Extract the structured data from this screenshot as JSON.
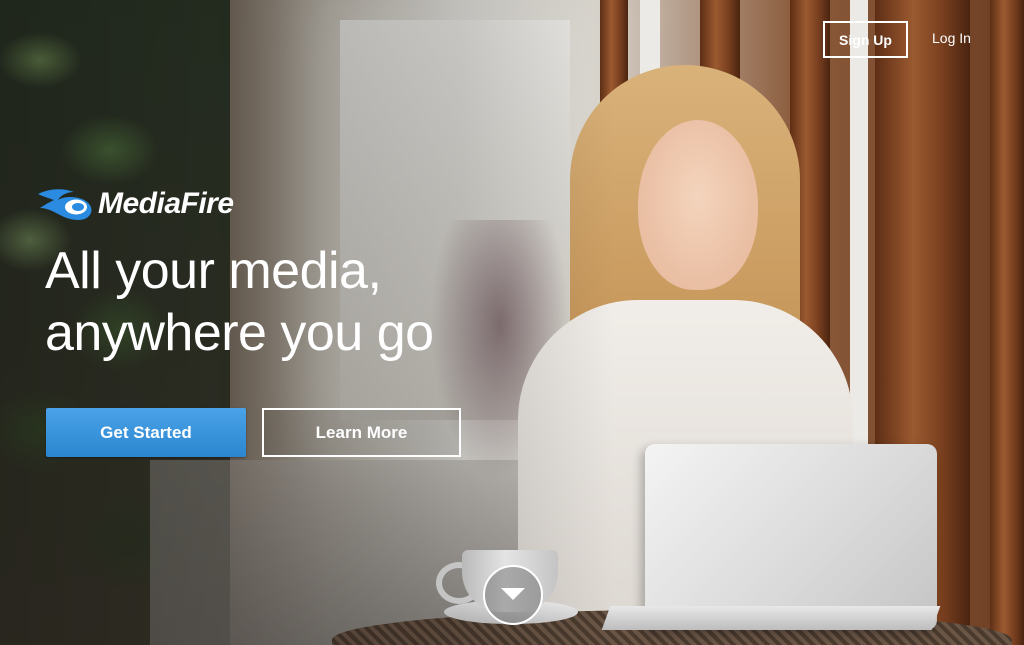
{
  "nav": {
    "signup_label": "Sign Up",
    "login_label": "Log In"
  },
  "logo": {
    "text": "MediaFire",
    "icon": "mediafire-flame-icon"
  },
  "hero": {
    "headline_line1": "All your media,",
    "headline_line2": "anywhere you go",
    "primary_cta": "Get Started",
    "secondary_cta": "Learn More",
    "scroll_icon": "chevron-down-icon"
  },
  "colors": {
    "primary_button": "#2c86cf",
    "logo_blue": "#2a8be0",
    "text": "#ffffff"
  }
}
